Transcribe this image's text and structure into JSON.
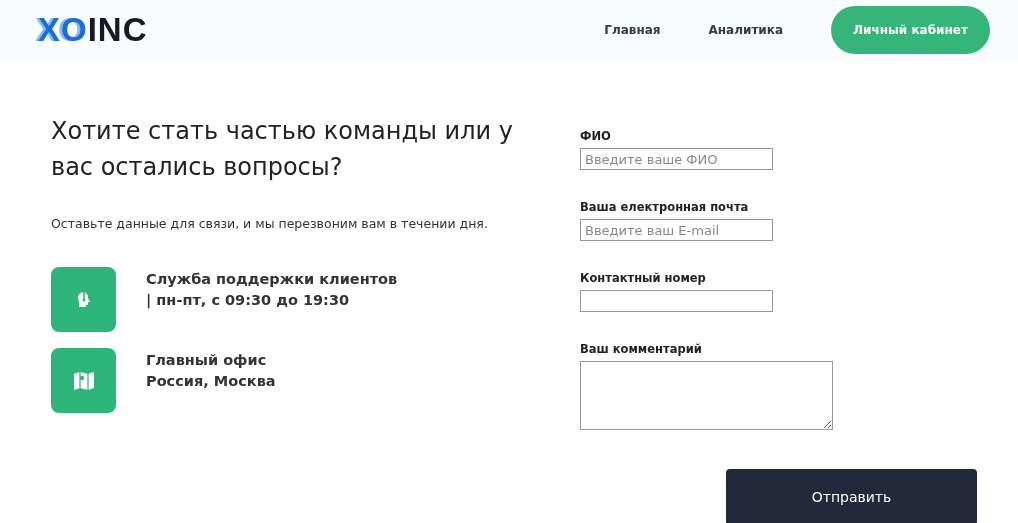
{
  "header": {
    "logo": {
      "accent": "XO",
      "rest": "INC"
    },
    "nav": [
      {
        "label": "Главная",
        "kind": "link"
      },
      {
        "label": "Аналитика",
        "kind": "link"
      },
      {
        "label": "Личный кабинет",
        "kind": "button"
      }
    ]
  },
  "intro": {
    "title": "Хотите стать частью команды или у вас остались вопросы?",
    "text": "Оставьте данные для связи, и мы перезвоним вам в течении дня."
  },
  "contacts": [
    {
      "kind": "support",
      "lines": [
        "Служба поддержки клиентов",
        "| пн-пт, с 09:30 до 19:30"
      ]
    },
    {
      "kind": "office",
      "lines": [
        "Главный офис",
        "Россия, Москва"
      ]
    }
  ],
  "form": {
    "fields": [
      {
        "kind": "input",
        "label": "ФИО",
        "placeholder": "Введите ваше ФИО"
      },
      {
        "kind": "input",
        "label": "Ваша електронная почта",
        "placeholder": "Введите ваш E-mail"
      },
      {
        "kind": "input",
        "label": "Контактный номер"
      },
      {
        "kind": "textarea",
        "label": "Ваш комментарий"
      }
    ],
    "submit": "Отправить"
  }
}
